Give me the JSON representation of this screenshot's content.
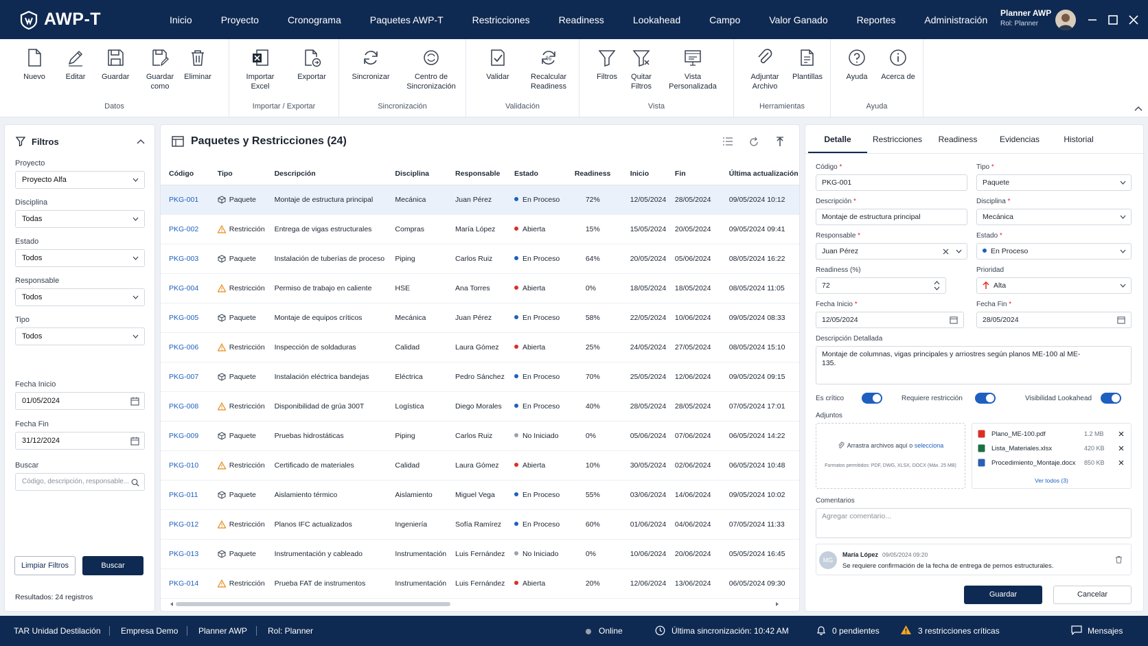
{
  "app": {
    "name": "AWP-T"
  },
  "nav": [
    "Inicio",
    "Proyecto",
    "Cronograma",
    "Paquetes AWP-T",
    "Restricciones",
    "Readiness",
    "Lookahead",
    "Campo",
    "Valor Ganado",
    "Reportes",
    "Administración"
  ],
  "user": {
    "name": "Planner AWP",
    "role": "Rol: Planner"
  },
  "ribbon": {
    "groups": [
      {
        "title": "Datos",
        "buttons": [
          {
            "label": "Nuevo",
            "icon": "file-icon"
          },
          {
            "label": "Editar",
            "icon": "pencil-icon"
          },
          {
            "label": "Guardar",
            "icon": "save-icon"
          },
          {
            "label": "Guardar como",
            "icon": "save-as-icon"
          },
          {
            "label": "Eliminar",
            "icon": "trash-icon"
          }
        ]
      },
      {
        "title": "Importar / Exportar",
        "buttons": [
          {
            "label": "Importar Excel",
            "icon": "excel-icon"
          },
          {
            "label": "Exportar",
            "icon": "export-icon"
          }
        ]
      },
      {
        "title": "Sincronización",
        "buttons": [
          {
            "label": "Sincronizar",
            "icon": "sync-icon"
          },
          {
            "label": "Centro de Sincronización",
            "icon": "sync-center-icon"
          }
        ]
      },
      {
        "title": "Validación",
        "buttons": [
          {
            "label": "Validar",
            "icon": "validate-icon"
          },
          {
            "label": "Recalcular Readiness",
            "icon": "recalc-icon"
          }
        ]
      },
      {
        "title": "Vista",
        "buttons": [
          {
            "label": "Filtros",
            "icon": "filter-icon"
          },
          {
            "label": "Quitar Filtros",
            "icon": "clear-filter-icon"
          },
          {
            "label": "Vista Personalizada",
            "icon": "custom-view-icon"
          }
        ]
      },
      {
        "title": "Herramientas",
        "buttons": [
          {
            "label": "Adjuntar Archivo",
            "icon": "paperclip-icon"
          },
          {
            "label": "Plantillas",
            "icon": "template-icon"
          }
        ]
      },
      {
        "title": "Ayuda",
        "buttons": [
          {
            "label": "Ayuda",
            "icon": "help-icon"
          },
          {
            "label": "Acerca de",
            "icon": "info-icon"
          }
        ]
      }
    ]
  },
  "filters": {
    "title": "Filtros",
    "fields": [
      {
        "label": "Proyecto",
        "value": "Proyecto Alfa"
      },
      {
        "label": "Disciplina",
        "value": "Todas"
      },
      {
        "label": "Estado",
        "value": "Todos"
      },
      {
        "label": "Responsable",
        "value": "Todos"
      },
      {
        "label": "Tipo",
        "value": "Todos"
      }
    ],
    "fecha_inicio_label": "Fecha Inicio",
    "fecha_inicio": "01/05/2024",
    "fecha_fin_label": "Fecha Fin",
    "fecha_fin": "31/12/2024",
    "buscar_label": "Buscar",
    "buscar_placeholder": "Código, descripción, responsable...",
    "clear_label": "Limpiar Filtros",
    "search_label": "Buscar",
    "results": "Resultados: 24 registros"
  },
  "grid": {
    "title": "Paquetes y Restricciones (24)",
    "columns": [
      "Código",
      "Tipo",
      "Descripción",
      "Disciplina",
      "Responsable",
      "Estado",
      "Readiness",
      "Inicio",
      "Fin",
      "Última actualización"
    ],
    "rows": [
      [
        "PKG-001",
        "Paquete",
        "Montaje de estructura principal",
        "Mecánica",
        "Juan Pérez",
        "En Proceso",
        "72%",
        "12/05/2024",
        "28/05/2024",
        "09/05/2024 10:12"
      ],
      [
        "PKG-002",
        "Restricción",
        "Entrega de vigas estructurales",
        "Compras",
        "María López",
        "Abierta",
        "15%",
        "15/05/2024",
        "20/05/2024",
        "09/05/2024 09:41"
      ],
      [
        "PKG-003",
        "Paquete",
        "Instalación de tuberías de proceso",
        "Piping",
        "Carlos Ruiz",
        "En Proceso",
        "64%",
        "20/05/2024",
        "05/06/2024",
        "08/05/2024 16:22"
      ],
      [
        "PKG-004",
        "Restricción",
        "Permiso de trabajo en caliente",
        "HSE",
        "Ana Torres",
        "Abierta",
        "0%",
        "18/05/2024",
        "18/05/2024",
        "08/05/2024 11:05"
      ],
      [
        "PKG-005",
        "Paquete",
        "Montaje de equipos críticos",
        "Mecánica",
        "Juan Pérez",
        "En Proceso",
        "58%",
        "22/05/2024",
        "10/06/2024",
        "09/05/2024 08:33"
      ],
      [
        "PKG-006",
        "Restricción",
        "Inspección de soldaduras",
        "Calidad",
        "Laura Gómez",
        "Abierta",
        "25%",
        "24/05/2024",
        "27/05/2024",
        "08/05/2024 15:10"
      ],
      [
        "PKG-007",
        "Paquete",
        "Instalación eléctrica bandejas",
        "Eléctrica",
        "Pedro Sánchez",
        "En Proceso",
        "70%",
        "25/05/2024",
        "12/06/2024",
        "09/05/2024 09:15"
      ],
      [
        "PKG-008",
        "Restricción",
        "Disponibilidad de grúa 300T",
        "Logística",
        "Diego Morales",
        "En Proceso",
        "40%",
        "28/05/2024",
        "28/05/2024",
        "07/05/2024 17:01"
      ],
      [
        "PKG-009",
        "Paquete",
        "Pruebas hidrostáticas",
        "Piping",
        "Carlos Ruiz",
        "No Iniciado",
        "0%",
        "05/06/2024",
        "07/06/2024",
        "06/05/2024 14:22"
      ],
      [
        "PKG-010",
        "Restricción",
        "Certificado de materiales",
        "Calidad",
        "Laura Gómez",
        "Abierta",
        "10%",
        "30/05/2024",
        "02/06/2024",
        "06/05/2024 10:48"
      ],
      [
        "PKG-011",
        "Paquete",
        "Aislamiento térmico",
        "Aislamiento",
        "Miguel Vega",
        "En Proceso",
        "55%",
        "03/06/2024",
        "14/06/2024",
        "09/05/2024 10:02"
      ],
      [
        "PKG-012",
        "Restricción",
        "Planos IFC actualizados",
        "Ingeniería",
        "Sofía Ramírez",
        "En Proceso",
        "60%",
        "01/06/2024",
        "04/06/2024",
        "07/05/2024 11:33"
      ],
      [
        "PKG-013",
        "Paquete",
        "Instrumentación y cableado",
        "Instrumentación",
        "Luis Fernández",
        "No Iniciado",
        "0%",
        "10/06/2024",
        "20/06/2024",
        "05/05/2024 16:45"
      ],
      [
        "PKG-014",
        "Restricción",
        "Prueba FAT de instrumentos",
        "Instrumentación",
        "Luis Fernández",
        "Abierta",
        "20%",
        "12/06/2024",
        "13/06/2024",
        "06/05/2024 09:30"
      ]
    ],
    "status_colors": {
      "En Proceso": "#1f5fbf",
      "Abierta": "#d93025",
      "No Iniciado": "#9aa1ab"
    }
  },
  "detail": {
    "tabs": [
      "Detalle",
      "Restricciones",
      "Readiness",
      "Evidencias",
      "Historial"
    ],
    "codigo_label": "Código",
    "codigo": "PKG-001",
    "tipo_label": "Tipo",
    "tipo": "Paquete",
    "descripcion_label": "Descripción",
    "descripcion": "Montaje de estructura principal",
    "disciplina_label": "Disciplina",
    "disciplina": "Mecánica",
    "responsable_label": "Responsable",
    "responsable": "Juan Pérez",
    "estado_label": "Estado",
    "estado": "En Proceso",
    "readiness_label": "Readiness (%)",
    "readiness": "72",
    "prioridad_label": "Prioridad",
    "prioridad": "Alta",
    "fecha_inicio_label": "Fecha Inicio",
    "fecha_inicio": "12/05/2024",
    "fecha_fin_label": "Fecha Fin",
    "fecha_fin": "28/05/2024",
    "desc_det_label": "Descripción Detallada",
    "desc_det": "Montaje de columnas, vigas principales y arriostres según planos ME-100 al ME-135.",
    "critico_label": "Es crítico",
    "requiere_label": "Requiere restricción",
    "lookahead_label": "Visibilidad Lookahead",
    "adjuntos_label": "Adjuntos",
    "drop_text": "Arrastra archivos aquí o",
    "drop_link": "selecciona",
    "drop_formats": "Formatos permitidos: PDF, DWG, XLSX, DOCX (Máx. 25 MB)",
    "files": [
      {
        "name": "Plano_ME-100.pdf",
        "size": "1.2 MB",
        "color": "#d93025",
        "icon": "pdf-icon"
      },
      {
        "name": "Lista_Materiales.xlsx",
        "size": "420 KB",
        "color": "#1d6f42",
        "icon": "excel-icon"
      },
      {
        "name": "Procedimiento_Montaje.docx",
        "size": "850 KB",
        "color": "#2b5fb5",
        "icon": "word-icon"
      }
    ],
    "ver_todos": "Ver todos (3)",
    "comentarios_label": "Comentarios",
    "comentario_placeholder": "Agregar comentario...",
    "comment": {
      "initials": "MG",
      "author": "María López",
      "time": "09/05/2024 09:20",
      "text": "Se requiere confirmación de la fecha de entrega de pernos estructurales."
    },
    "guardar": "Guardar",
    "cancelar": "Cancelar"
  },
  "statusbar": {
    "items": [
      "TAR Unidad Destilación",
      "Empresa Demo",
      "Planner AWP",
      "Rol: Planner"
    ],
    "online": "Online",
    "sync": "Última sincronización: 10:42 AM",
    "pending": "0 pendientes",
    "critical": "3 restricciones críticas",
    "messages": "Mensajes"
  }
}
